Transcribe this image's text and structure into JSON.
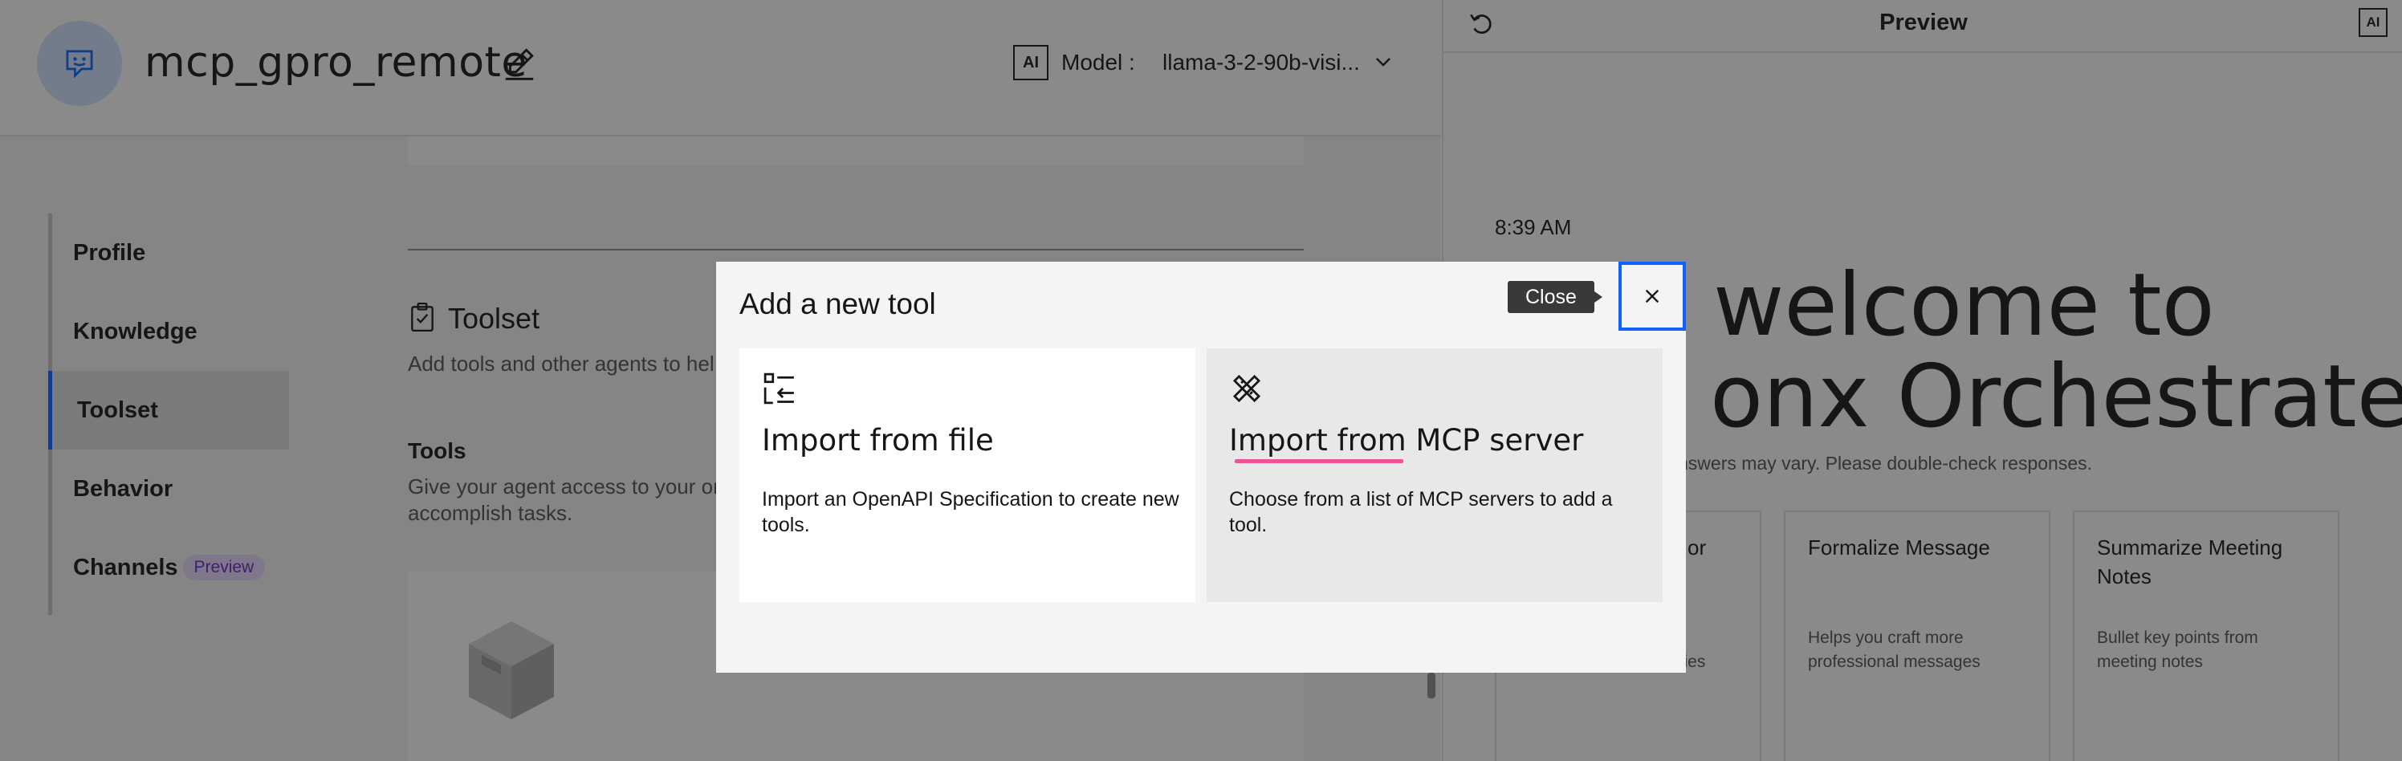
{
  "header": {
    "agent_name": "mcp_gpro_remote",
    "ai_badge": "AI",
    "model_label": "Model :",
    "model_value": "llama-3-2-90b-visi..."
  },
  "nav": {
    "items": [
      {
        "label": "Profile"
      },
      {
        "label": "Knowledge"
      },
      {
        "label": "Toolset",
        "active": true
      },
      {
        "label": "Behavior"
      },
      {
        "label": "Channels",
        "tag": "Preview"
      }
    ]
  },
  "toolset": {
    "title": "Toolset",
    "description": "Add tools and other agents to hel",
    "tools_title": "Tools",
    "tools_description": "Give your agent access to your or accomplish tasks."
  },
  "preview": {
    "title": "Preview",
    "ai_badge": "AI",
    "time": "8:39 AM",
    "welcome_line1": "welcome to",
    "welcome_line2": "onx Orchestrate",
    "disclaimer": "nswers may vary. Please double-check responses.",
    "cards": [
      {
        "title": "or",
        "description": "g and Gen AI capabilities"
      },
      {
        "title": "Formalize Message",
        "description": "Helps you craft more professional messages"
      },
      {
        "title": "Summarize Meeting Notes",
        "description": "Bullet key points from meeting notes"
      }
    ]
  },
  "modal": {
    "title": "Add a new tool",
    "close_tooltip": "Close",
    "options": [
      {
        "title": "Import from file",
        "description": "Import an OpenAPI Specification to create new tools.",
        "icon": "import-list-icon"
      },
      {
        "title": "Import from MCP server",
        "description": "Choose from a list of MCP servers to add a tool.",
        "icon": "tools-icon"
      }
    ]
  },
  "colors": {
    "accent": "#0f62fe",
    "tag_bg": "#e8daff",
    "tag_text": "#6929c4",
    "underline": "#ee5396"
  }
}
